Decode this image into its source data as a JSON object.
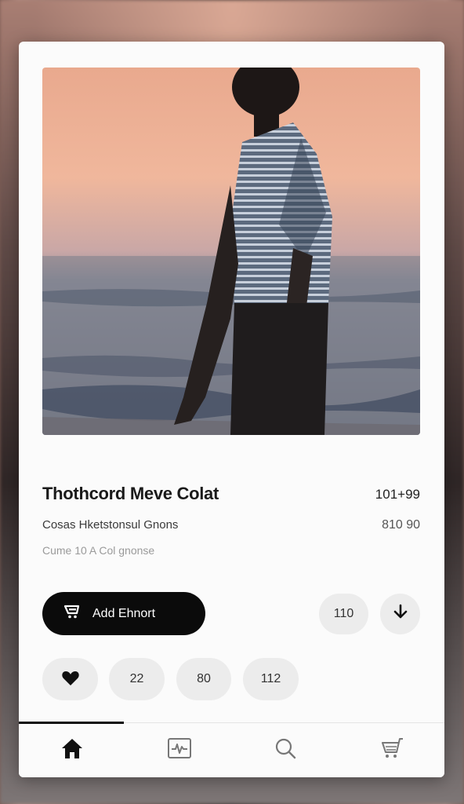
{
  "product": {
    "title": "Thothcord Meve Colat",
    "price": "101+99",
    "subtitle": "Cosas Hketstonsul Gnons",
    "price_secondary": "810 90",
    "meta": "Cume 10 A Col gnonse"
  },
  "actions": {
    "add_to_cart_label": "Add Ehnort",
    "quantity": "110",
    "chips": [
      "22",
      "80",
      "112"
    ]
  },
  "icons": {
    "cart": "cart-icon",
    "download": "arrow-down-icon",
    "like": "heart-icon",
    "home": "home-icon",
    "activity": "activity-icon",
    "search": "search-icon",
    "shop": "cart-icon"
  },
  "colors": {
    "accent": "#0b0b0b",
    "chip_bg": "#ececec",
    "card_bg": "#fbfbfb"
  }
}
